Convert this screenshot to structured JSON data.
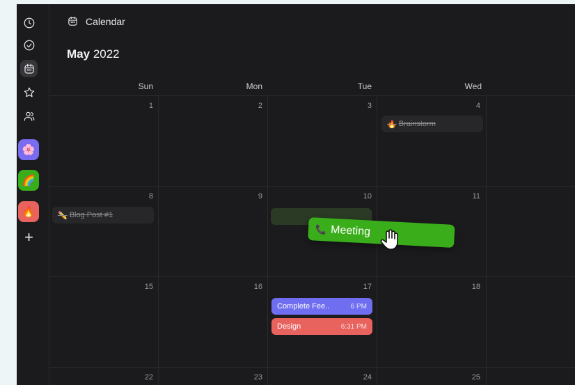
{
  "header": {
    "title": "Calendar",
    "month": "May",
    "year": "2022"
  },
  "rail": {
    "icons": [
      "clock-icon",
      "check-circle-icon",
      "calendar-icon",
      "star-icon",
      "users-icon"
    ],
    "apps": [
      {
        "emoji": "🌸",
        "color": "#7a6cf0"
      },
      {
        "emoji": "🌈",
        "color": "#3aad1a"
      },
      {
        "emoji": "🔥",
        "color": "#e8625e"
      }
    ],
    "add_label": "+"
  },
  "weekdays": [
    "Sun",
    "Mon",
    "Tue",
    "Wed"
  ],
  "weeks": [
    {
      "days": [
        "1",
        "2",
        "3",
        "4"
      ]
    },
    {
      "days": [
        "8",
        "9",
        "10",
        "11"
      ]
    },
    {
      "days": [
        "15",
        "16",
        "17",
        "18"
      ]
    },
    {
      "days": [
        "22",
        "23",
        "24",
        "25"
      ]
    }
  ],
  "events": {
    "brainstorm": {
      "emoji": "🔥",
      "title": "Brainstorm"
    },
    "blog": {
      "emoji": "✏️",
      "title": "Blog Post #1"
    },
    "meeting": {
      "emoji": "📞",
      "title": "Meeting"
    },
    "feedback": {
      "title": "Complete Fee..",
      "time": "6 PM"
    },
    "design": {
      "title": "Design",
      "time": "6:31 PM"
    }
  }
}
